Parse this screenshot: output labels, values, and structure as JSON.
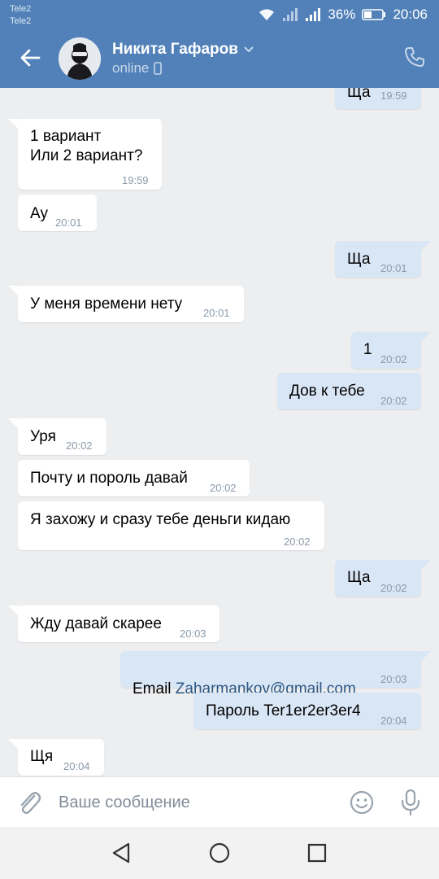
{
  "status_bar": {
    "carrier1": "Tele2",
    "carrier2": "Tele2",
    "battery": "36%",
    "time": "20:06"
  },
  "header": {
    "contact_name": "Никита Гафаров",
    "status": "online"
  },
  "messages": [
    {
      "dir": "out",
      "text": "Ща",
      "time": "19:59"
    },
    {
      "dir": "in",
      "text": "1 вариант\nИли 2 вариант?",
      "time": "19:59"
    },
    {
      "dir": "in",
      "text": "Ау",
      "time": "20:01"
    },
    {
      "dir": "out",
      "text": "Ща",
      "time": "20:01"
    },
    {
      "dir": "in",
      "text": "У меня времени нету",
      "time": "20:01"
    },
    {
      "dir": "out",
      "text": "1",
      "time": "20:02"
    },
    {
      "dir": "out",
      "text": "Дов к тебе",
      "time": "20:02"
    },
    {
      "dir": "in",
      "text": "Уря",
      "time": "20:02"
    },
    {
      "dir": "in",
      "text": "Почту и пороль давай",
      "time": "20:02"
    },
    {
      "dir": "in",
      "text": "Я захожу и сразу тебе деньги кидаю",
      "time": "20:02"
    },
    {
      "dir": "out",
      "text": "Ща",
      "time": "20:02"
    },
    {
      "dir": "in",
      "text": "Жду давай скарее",
      "time": "20:03"
    },
    {
      "dir": "out",
      "text_prefix": "Email ",
      "link": "Zaharmankov@gmail.com",
      "time": "20:03"
    },
    {
      "dir": "out",
      "text": "Пароль Ter1er2er3er4",
      "time": "20:04"
    },
    {
      "dir": "in",
      "text": "Щя",
      "time": "20:04"
    }
  ],
  "composer": {
    "placeholder": "Ваше сообщение"
  },
  "colors": {
    "header_blue": "#5181b8",
    "chat_bg": "#edeef0",
    "outgoing_bubble": "#d9e6f5",
    "incoming_bubble": "#ffffff",
    "link": "#2a5885"
  },
  "icons": {
    "back": "arrow-left-icon",
    "call": "phone-icon",
    "attach": "paperclip-icon",
    "emoji": "smiley-icon",
    "mic": "microphone-icon",
    "nav_back": "triangle-back-icon",
    "nav_home": "circle-home-icon",
    "nav_recent": "square-recents-icon"
  }
}
